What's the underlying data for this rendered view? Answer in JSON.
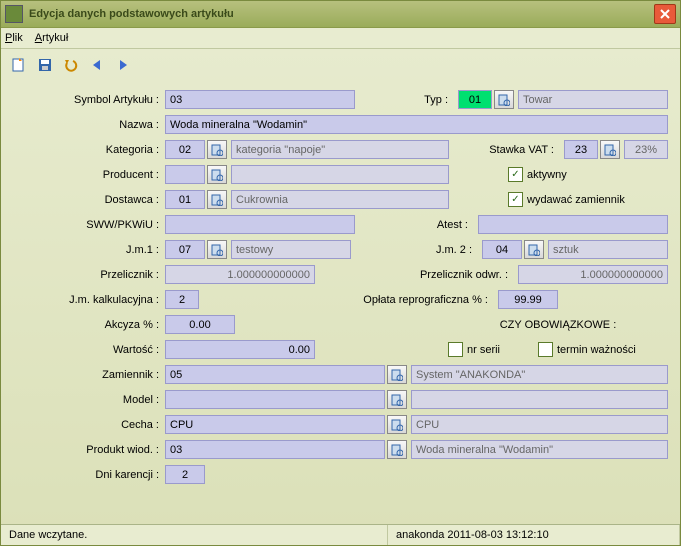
{
  "window": {
    "title": "Edycja danych podstawowych artykułu"
  },
  "menu": {
    "plik": "Plik",
    "artykul": "Artykuł"
  },
  "labels": {
    "symbol": "Symbol Artykułu :",
    "typ": "Typ :",
    "nazwa": "Nazwa :",
    "kategoria": "Kategoria :",
    "stawka_vat": "Stawka VAT :",
    "producent": "Producent :",
    "dostawca": "Dostawca :",
    "sww": "SWW/PKWiU :",
    "atest": "Atest :",
    "jm1": "J.m.1 :",
    "jm2": "J.m. 2 :",
    "przelicznik": "Przelicznik :",
    "przelicznik_odwr": "Przelicznik odwr. :",
    "jm_kalk": "J.m. kalkulacyjna :",
    "oplata_repr": "Opłata reprograficzna % :",
    "akcyza": "Akcyza % :",
    "czy_obow": "CZY OBOWIĄZKOWE :",
    "wartosc": "Wartość :",
    "nr_serii": "nr serii",
    "termin": "termin ważności",
    "zamiennik": "Zamiennik :",
    "model": "Model :",
    "cecha": "Cecha :",
    "produkt_wiod": "Produkt wiod. :",
    "dni_karencji": "Dni karencji :",
    "aktywny": "aktywny",
    "wydawac": "wydawać zamiennik"
  },
  "values": {
    "symbol": "03",
    "typ": "01",
    "typ_desc": "Towar",
    "nazwa": "Woda mineralna \"Wodamin\"",
    "kategoria": "02",
    "kategoria_desc": "kategoria \"napoje\"",
    "stawka_vat": "23",
    "stawka_vat_desc": "23%",
    "producent": "",
    "producent_desc": "",
    "dostawca": "01",
    "dostawca_desc": "Cukrownia",
    "sww": "",
    "atest": "",
    "jm1": "07",
    "jm1_desc": "testowy",
    "jm2": "04",
    "jm2_desc": "sztuk",
    "przelicznik": "1.000000000000",
    "przelicznik_odwr": "1.000000000000",
    "jm_kalk": "2",
    "oplata_repr": "99.99",
    "akcyza": "0.00",
    "wartosc": "0.00",
    "zamiennik": "05",
    "zamiennik_desc": "System \"ANAKONDA\"",
    "model": "",
    "model_desc": "",
    "cecha": "CPU",
    "cecha_desc": "CPU",
    "produkt_wiod": "03",
    "produkt_wiod_desc": "Woda mineralna \"Wodamin\"",
    "dni_karencji": "2"
  },
  "checks": {
    "aktywny": true,
    "wydawac": true,
    "nr_serii": false,
    "termin": false
  },
  "status": {
    "left": "Dane wczytane.",
    "right": "anakonda  2011-08-03 13:12:10"
  }
}
